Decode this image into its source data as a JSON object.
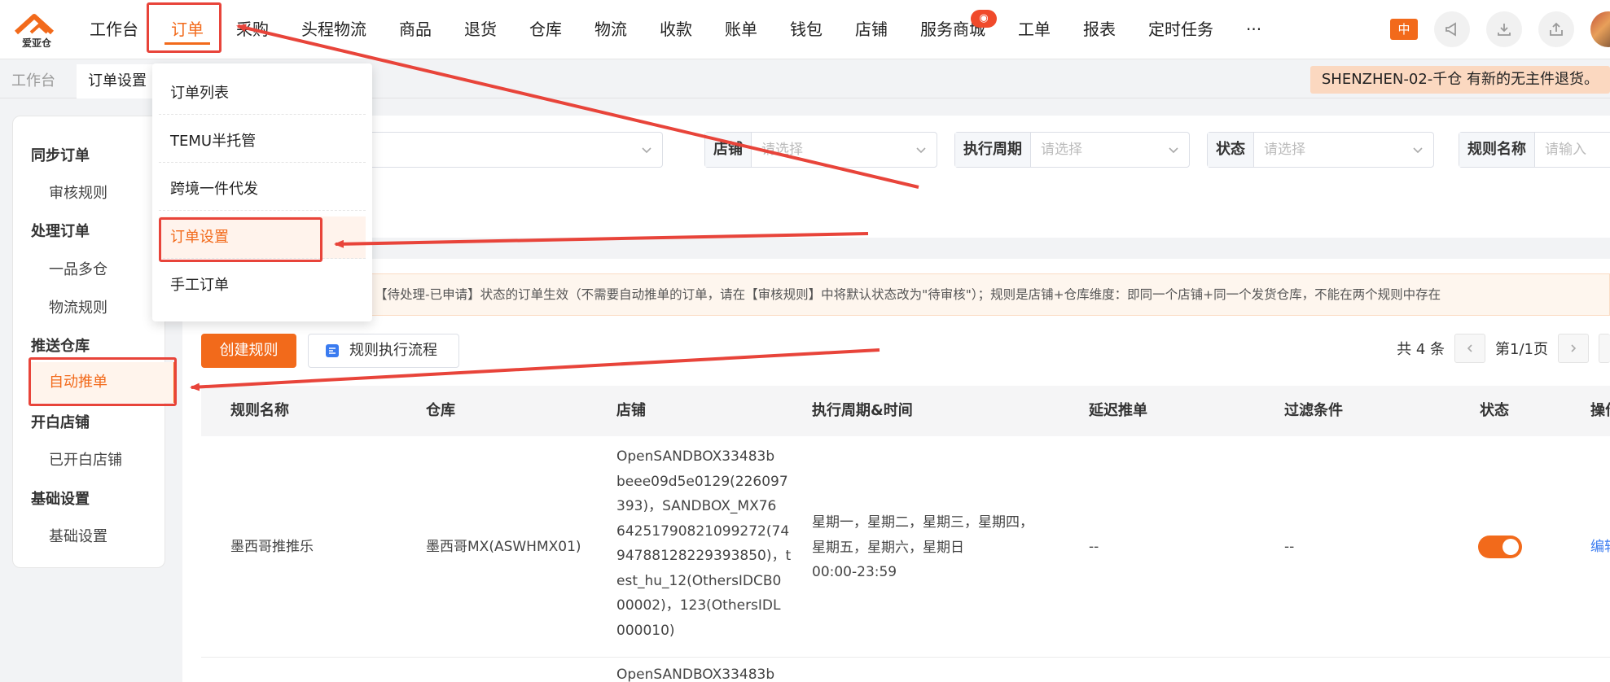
{
  "brand": {
    "logo_text": "爱亚仓",
    "accent": "#f26a1b"
  },
  "nav": {
    "items": [
      {
        "label": "工作台"
      },
      {
        "label": "订单",
        "active": true
      },
      {
        "label": "采购"
      },
      {
        "label": "头程物流"
      },
      {
        "label": "商品"
      },
      {
        "label": "退货"
      },
      {
        "label": "仓库"
      },
      {
        "label": "物流"
      },
      {
        "label": "收款"
      },
      {
        "label": "账单"
      },
      {
        "label": "钱包"
      },
      {
        "label": "店铺"
      },
      {
        "label": "服务商城"
      },
      {
        "label": "工单"
      },
      {
        "label": "报表"
      },
      {
        "label": "定时任务"
      },
      {
        "label": "···"
      }
    ],
    "lang": "中"
  },
  "tabs": {
    "home": "工作台",
    "current": "订单设置"
  },
  "notice": "SHENZHEN-02-千仓 有新的无主件退货。",
  "sidebar": {
    "groups": [
      {
        "title": "同步订单",
        "items": [
          "审核规则"
        ]
      },
      {
        "title": "处理订单",
        "items": [
          "一品多仓",
          "物流规则"
        ]
      },
      {
        "title": "推送仓库",
        "items": [
          "自动推单"
        ]
      },
      {
        "title": "开白店铺",
        "items": [
          "已开白店铺"
        ]
      },
      {
        "title": "基础设置",
        "items": [
          "基础设置"
        ]
      }
    ],
    "active": "自动推单"
  },
  "dropdown": {
    "items": [
      "订单列表",
      "TEMU半托管",
      "跨境一件代发",
      "订单设置",
      "手工订单"
    ],
    "active": "订单设置"
  },
  "filters": {
    "shop": {
      "label": "店铺",
      "placeholder": "请选择"
    },
    "cycle": {
      "label": "执行周期",
      "placeholder": "请选择"
    },
    "status": {
      "label": "状态",
      "placeholder": "请选择"
    },
    "rule_name": {
      "label": "规则名称",
      "placeholder": "请输入"
    }
  },
  "tip": "【待处理-已申请】状态的订单生效（不需要自动推单的订单，请在【审核规则】中将默认状态改为\"待审核\"）；规则是店铺+仓库维度：即同一个店铺+同一个发货仓库，不能在两个规则中存在",
  "actions": {
    "create": "创建规则",
    "flow": "规则执行流程"
  },
  "pager": {
    "total": "共 4 条",
    "page": "第1/1页"
  },
  "table": {
    "headers": [
      "规则名称",
      "仓库",
      "店铺",
      "执行周期&时间",
      "延迟推单",
      "过滤条件",
      "状态",
      "操作"
    ],
    "rows": [
      {
        "name": "墨西哥推推乐",
        "warehouse": "墨西哥MX(ASWHMX01)",
        "shop_lines": [
          "OpenSANDBOX33483b",
          "beee09d5e0129(226097",
          "393)，SANDBOX_MX76",
          "64251790821099272(74",
          "94788128229393850)，t",
          "est_hu_12(OthersIDCB0",
          "00002)，123(OthersIDL",
          "000010)"
        ],
        "cycle_lines": [
          "星期一，星期二，星期三，星期四，",
          "星期五，星期六，星期日",
          "00:00-23:59"
        ],
        "delay": "--",
        "filter": "--",
        "status_on": true,
        "op": "编辑"
      },
      {
        "shop_lines": [
          "OpenSANDBOX33483b"
        ]
      }
    ]
  }
}
